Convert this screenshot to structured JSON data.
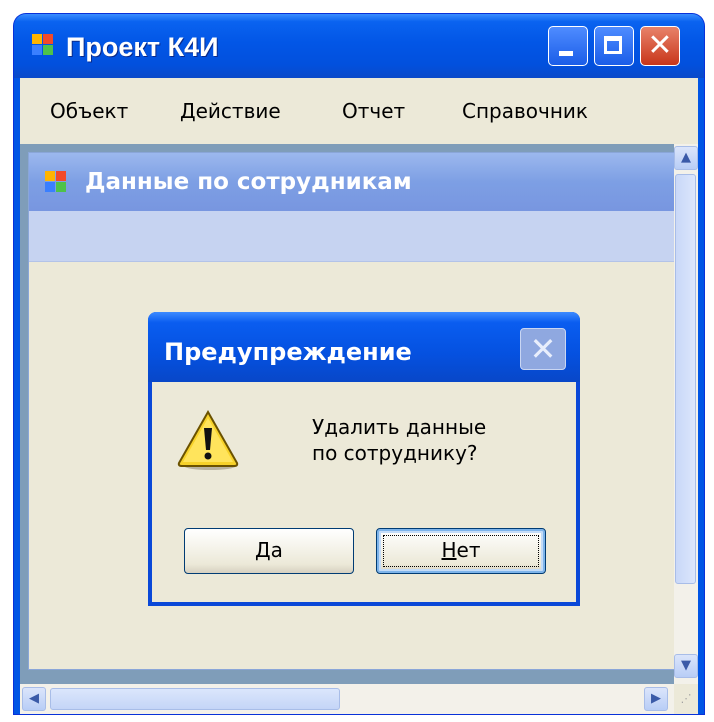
{
  "main_window": {
    "title": "Проект К4И",
    "icon": "app-icon",
    "caption_buttons": [
      "minimize-icon",
      "maximize-icon",
      "close-icon"
    ],
    "menu": [
      "Объект",
      "Действие",
      "Отчет",
      "Справочник"
    ]
  },
  "child_window": {
    "title": "Данные по сотрудникам",
    "icon": "app-icon"
  },
  "dialog": {
    "title": "Предупреждение",
    "icon": "warning-icon",
    "message_line1": "Удалить данные",
    "message_line2": "по сотруднику?",
    "yes_mnemonic": "Д",
    "yes_rest": "а",
    "no_mnemonic": "Н",
    "no_rest": "ет"
  },
  "colors": {
    "xp_title_blue": "#0256e6",
    "face": "#ece9d8",
    "close_red": "#c8361a"
  }
}
